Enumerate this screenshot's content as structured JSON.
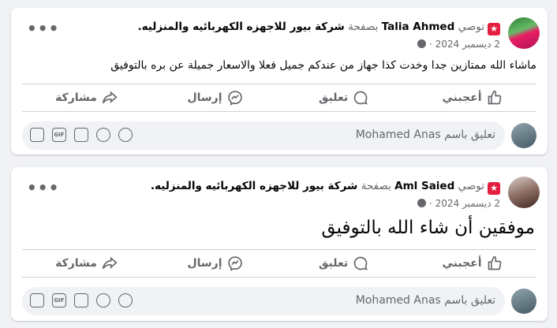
{
  "posts": [
    {
      "badge_label": "توصي",
      "author": "Talia Ahmed",
      "on_page": "بصفحة",
      "page_name": "شركة بيور للاجهزه الكهربائيه والمنزليه.",
      "date": "2 ديسمبر 2024 ·",
      "text": "ماشاء الله ممتازين جدا وخدت كذا جهاز من عندكم جميل فعلا والاسعار جميلة عن بره بالتوفيق"
    },
    {
      "badge_label": "توصي",
      "author": "Aml Saied",
      "on_page": "بصفحة",
      "page_name": "شركة بيور للاجهزه الكهربائيه والمنزليه.",
      "date": "2 ديسمبر 2024 ·",
      "text": "موفقين أن شاء الله بالتوفيق"
    }
  ],
  "actions": {
    "like": "أعجبني",
    "comment": "تعليق",
    "send": "إرسال",
    "share": "مشاركة"
  },
  "comment_box": {
    "placeholder": "تعليق باسم Mohamed Anas"
  },
  "tools": {
    "gif": "GIF"
  },
  "menu": {
    "dots": "•••"
  },
  "colors": {
    "accent": "#e41e3f",
    "muted": "#65676b"
  }
}
